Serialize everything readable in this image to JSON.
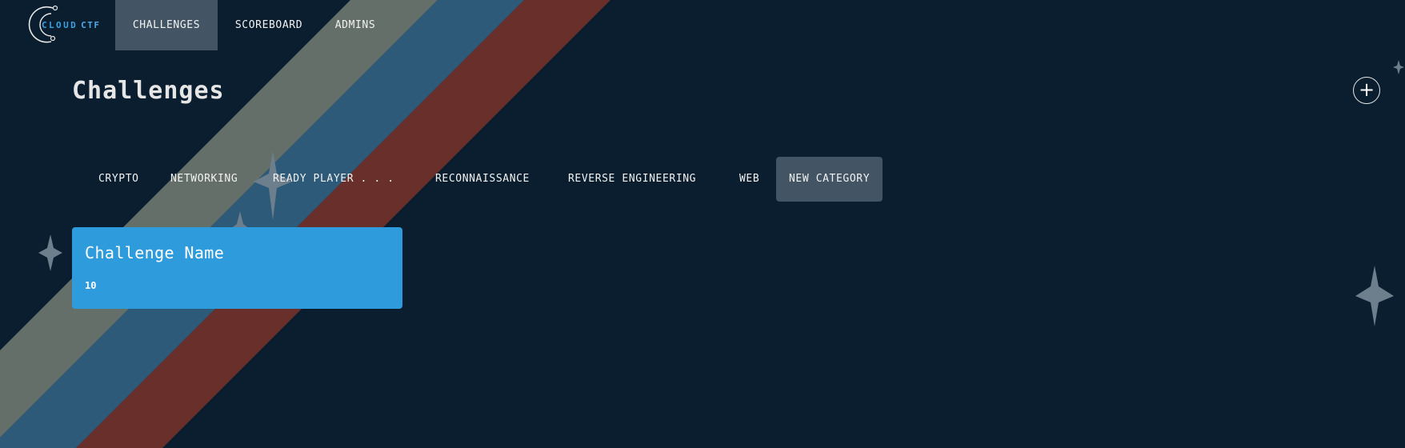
{
  "app": {
    "logo": {
      "text_part1": "CLOUD",
      "text_part2": "CTF"
    }
  },
  "nav": {
    "items": [
      {
        "label": "CHALLENGES",
        "active": true
      },
      {
        "label": "SCOREBOARD",
        "active": false
      },
      {
        "label": "ADMINS",
        "active": false
      }
    ]
  },
  "page": {
    "title": "Challenges",
    "add_button_icon": "plus-icon"
  },
  "categories": {
    "items": [
      {
        "label": "CRYPTO",
        "active": false
      },
      {
        "label": "NETWORKING",
        "active": false
      },
      {
        "label": "READY PLAYER . . .",
        "active": false
      },
      {
        "label": "RECONNAISSANCE",
        "active": false
      },
      {
        "label": "REVERSE ENGINEERING",
        "active": false
      },
      {
        "label": "WEB",
        "active": false
      },
      {
        "label": "NEW CATEGORY",
        "active": true
      }
    ]
  },
  "challenges": [
    {
      "name": "Challenge Name",
      "value": "10"
    }
  ],
  "theme": {
    "background": "#0a1e2f",
    "stripe_gray": "#646f69",
    "stripe_blue": "#2c5a78",
    "stripe_red": "#69302b",
    "active_tab": "#435564",
    "card": "#2e9bdc",
    "sparkle": "#6d7f8d"
  }
}
